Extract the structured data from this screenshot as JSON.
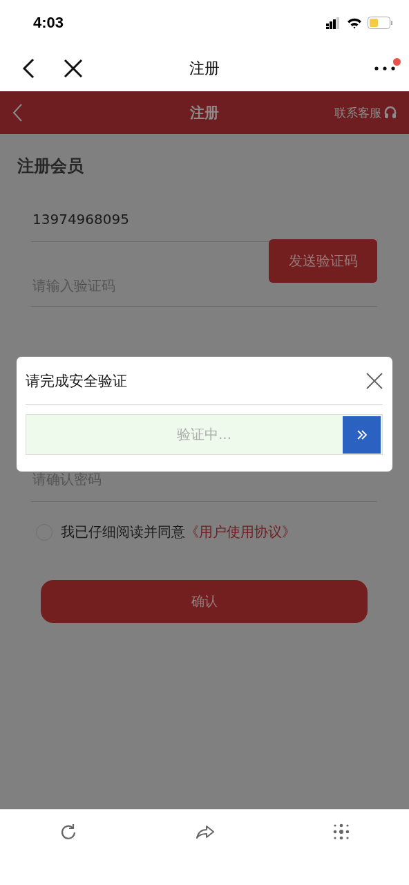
{
  "status_bar": {
    "time": "4:03"
  },
  "nav_bar": {
    "title": "注册",
    "notification": true
  },
  "header": {
    "title": "注册",
    "service_link": "联系客服"
  },
  "form": {
    "heading": "注册会员",
    "phone": {
      "value": "13974968095"
    },
    "code": {
      "placeholder": "请输入验证码",
      "button": "发送验证码"
    },
    "confirm_password": {
      "placeholder": "请确认密码"
    },
    "agreement": {
      "checked": false,
      "text": "我已仔细阅读并同意",
      "link": "《用户使用协议》"
    },
    "submit": "确认"
  },
  "dialog": {
    "title": "请完成安全验证",
    "slider": {
      "text": "验证中...",
      "level": 1
    }
  }
}
